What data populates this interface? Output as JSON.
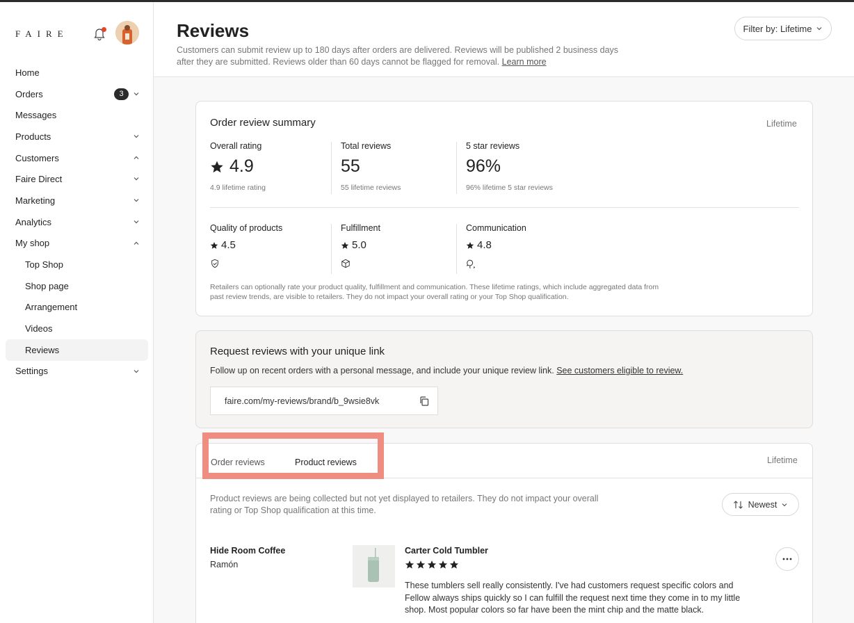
{
  "brand": {
    "logo": "FAIRE"
  },
  "sidebar": {
    "items": [
      {
        "label": "Home"
      },
      {
        "label": "Orders",
        "badge": "3"
      },
      {
        "label": "Messages"
      },
      {
        "label": "Products"
      },
      {
        "label": "Customers"
      },
      {
        "label": "Faire Direct"
      },
      {
        "label": "Marketing"
      },
      {
        "label": "Analytics"
      },
      {
        "label": "My shop"
      },
      {
        "label": "Top Shop"
      },
      {
        "label": "Shop page"
      },
      {
        "label": "Arrangement"
      },
      {
        "label": "Videos"
      },
      {
        "label": "Reviews"
      },
      {
        "label": "Settings"
      }
    ]
  },
  "header": {
    "title": "Reviews",
    "description": "Customers can submit review up to 180 days after orders are delivered. Reviews will be published 2 business days after they are submitted. Reviews older than 60 days cannot be flagged for removal.",
    "learn_more": "Learn more",
    "filter_label": "Filter by: Lifetime"
  },
  "summary": {
    "title": "Order review summary",
    "period": "Lifetime",
    "overall": {
      "label": "Overall rating",
      "value": "4.9",
      "sub": "4.9 lifetime rating"
    },
    "total": {
      "label": "Total reviews",
      "value": "55",
      "sub": "55 lifetime reviews"
    },
    "five_star": {
      "label": "5 star reviews",
      "value": "96%",
      "sub": "96% lifetime 5 star reviews"
    },
    "quality": {
      "label": "Quality of products",
      "value": "4.5"
    },
    "fulfillment": {
      "label": "Fulfillment",
      "value": "5.0"
    },
    "communication": {
      "label": "Communication",
      "value": "4.8"
    },
    "note": "Retailers can optionally rate your product quality, fulfillment and communication. These lifetime ratings, which include aggregated data from past review trends, are visible to retailers. They do not impact your overall rating or your Top Shop qualification."
  },
  "request": {
    "title": "Request reviews with your unique link",
    "description": "Follow up on recent orders with a personal message, and include your unique review link.",
    "eligible_link": "See customers eligible to review.",
    "url": "faire.com/my-reviews/brand/b_9wsie8vk"
  },
  "reviews": {
    "tabs": [
      {
        "label": "Order reviews"
      },
      {
        "label": "Product reviews"
      }
    ],
    "period": "Lifetime",
    "note": "Product reviews are being collected but not yet displayed to retailers. They do not impact your overall rating or Top Shop qualification at this time.",
    "sort_label": "Newest",
    "items": [
      {
        "store": "Hide Room Coffee",
        "user": "Ramón",
        "product": "Carter Cold Tumbler",
        "rating": 5,
        "text": "These tumblers sell really consistently. I've had customers request specific colors and Fellow always ships quickly so I can fulfill the request next time they come in to my little shop. Most popular colors so far have been the mint chip and the matte black."
      }
    ]
  },
  "colors": {
    "highlight": "#ee8d80",
    "notification": "#e2452e",
    "badge": "#2b2b2b"
  }
}
